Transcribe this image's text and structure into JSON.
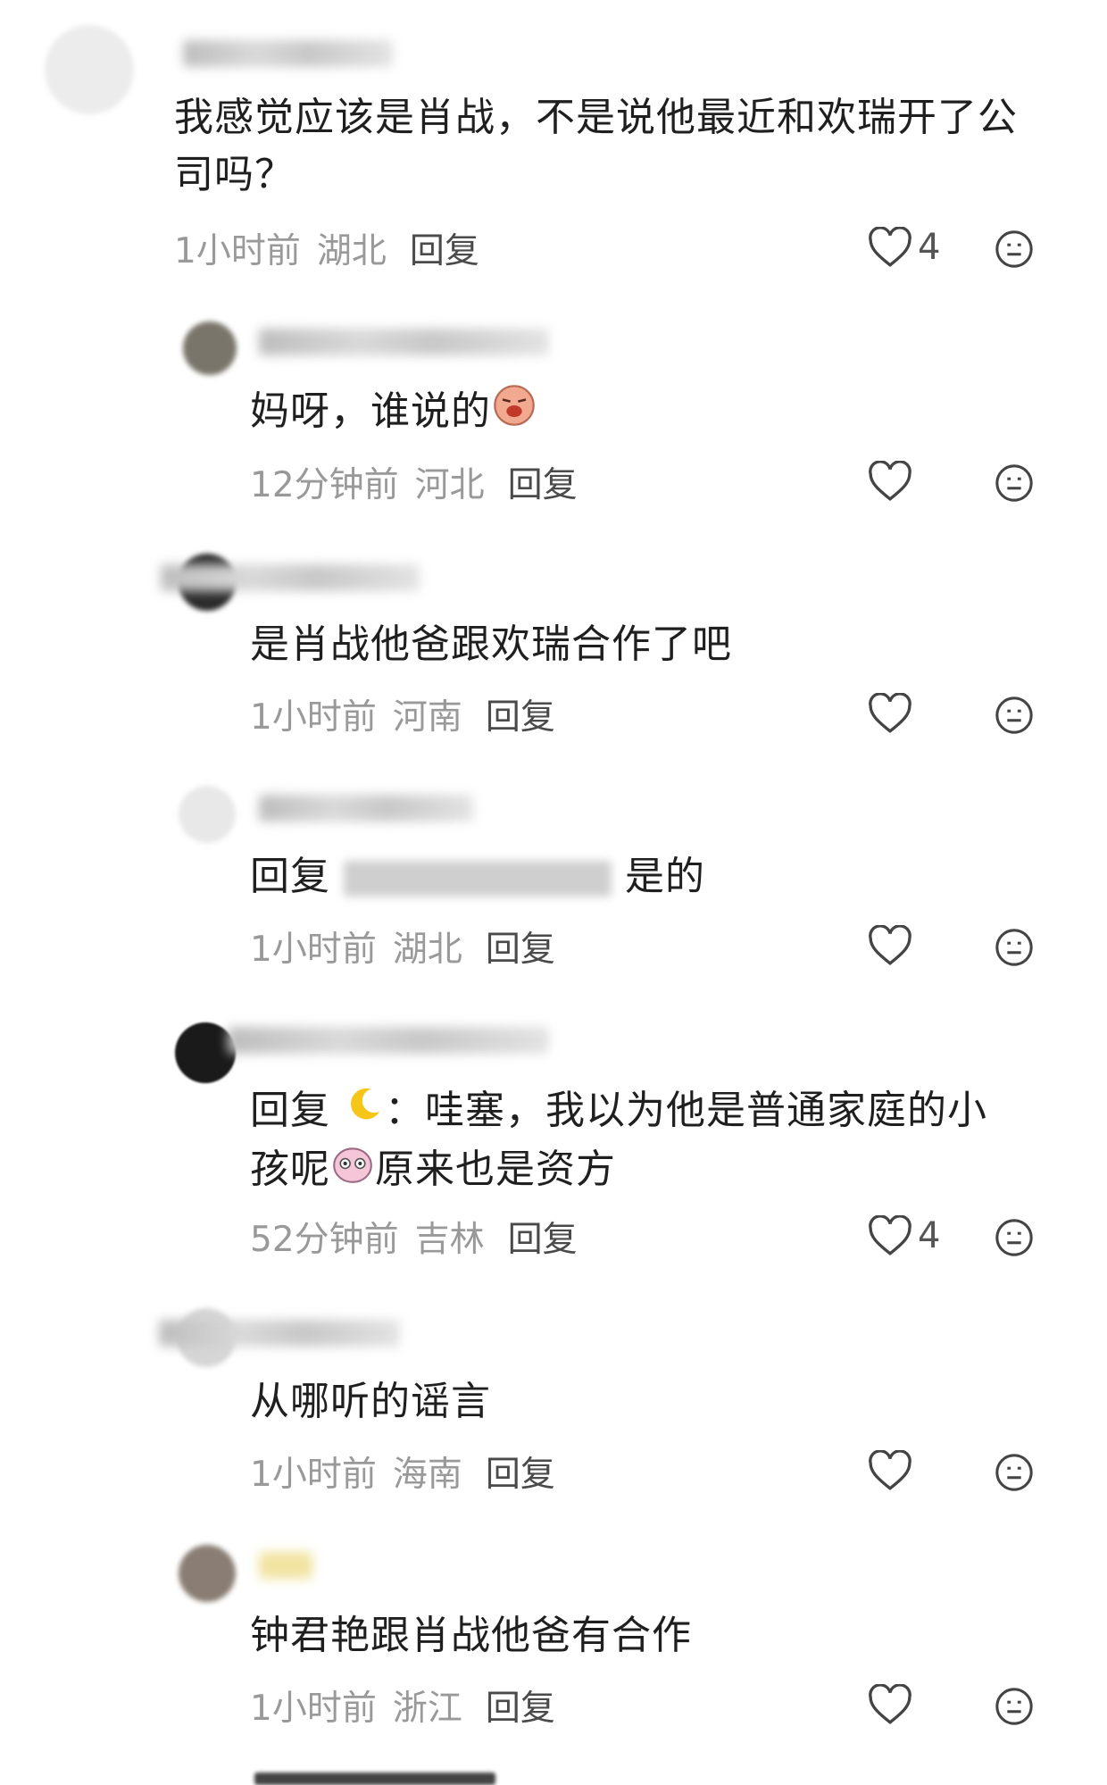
{
  "comments": [
    {
      "text": "我感觉应该是肖战，不是说他最近和欢瑞开了公司吗？",
      "time": "1小时前",
      "place": "湖北",
      "reply": "回复",
      "likes": "4"
    },
    {
      "text": "妈呀，谁说的",
      "emoji": "crying-face",
      "time": "12分钟前",
      "place": "河北",
      "reply": "回复",
      "likes": ""
    },
    {
      "text": "是肖战他爸跟欢瑞合作了吧",
      "time": "1小时前",
      "place": "河南",
      "reply": "回复",
      "likes": ""
    },
    {
      "text_prefix": "回复",
      "text_suffix": "是的",
      "time": "1小时前",
      "place": "湖北",
      "reply": "回复",
      "likes": ""
    },
    {
      "text_prefix": "回复",
      "text_line1": "：哇塞，我以为他是普通家庭的小",
      "text_line2_a": "孩呢",
      "text_line2_b": "原来也是资方",
      "emoji_moon": "moon",
      "emoji_face": "cute-face",
      "time": "52分钟前",
      "place": "吉林",
      "reply": "回复",
      "likes": "4"
    },
    {
      "text": "从哪听的谣言",
      "time": "1小时前",
      "place": "海南",
      "reply": "回复",
      "likes": ""
    },
    {
      "text": "钟君艳跟肖战他爸有合作",
      "time": "1小时前",
      "place": "浙江",
      "reply": "回复",
      "likes": ""
    }
  ],
  "colors": {
    "meta": "#999999",
    "text": "#1f1f1f",
    "icon": "#444444"
  }
}
